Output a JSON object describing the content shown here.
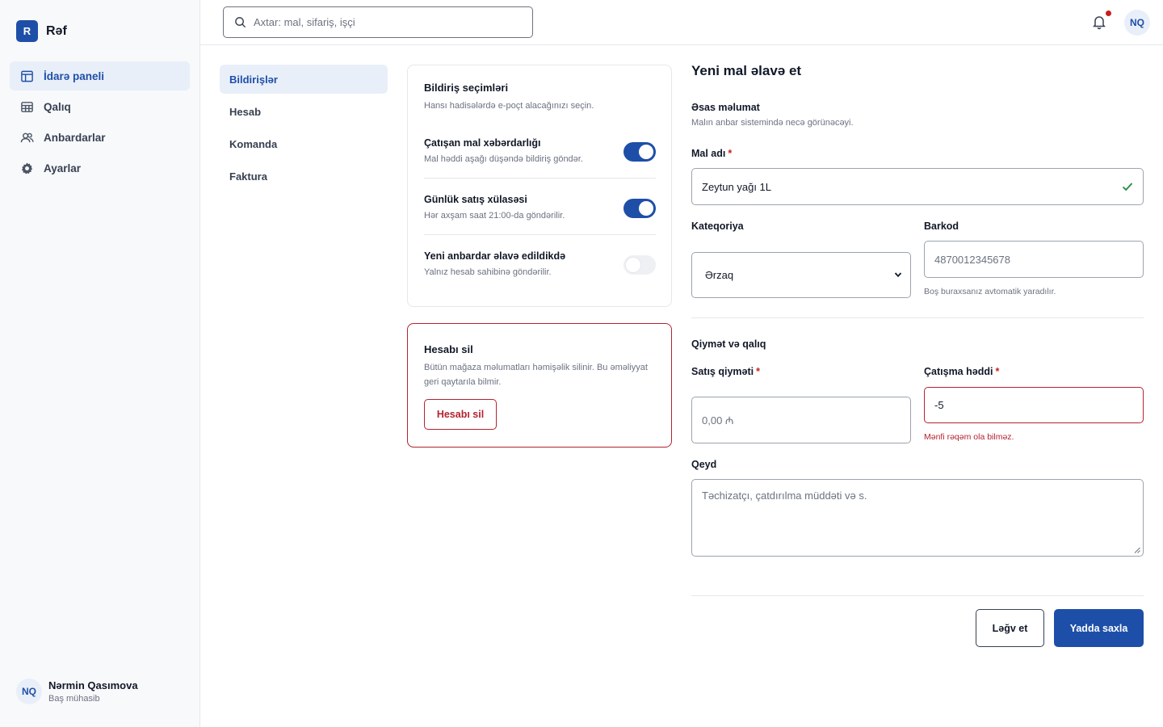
{
  "brand": {
    "logo_letter": "R",
    "name": "Rəf"
  },
  "sidebar": {
    "items": [
      {
        "label": "İdarə paneli",
        "icon": "layout-icon",
        "active": true
      },
      {
        "label": "Qalıq",
        "icon": "table-icon",
        "active": false
      },
      {
        "label": "Anbardarlar",
        "icon": "users-icon",
        "active": false
      },
      {
        "label": "Ayarlar",
        "icon": "gear-icon",
        "active": false
      }
    ],
    "user": {
      "initials": "NQ",
      "name": "Nərmin Qasımova",
      "role": "Baş mühasib"
    }
  },
  "topbar": {
    "search_placeholder": "Axtar: mal, sifariş, işçi",
    "avatar_initials": "NQ",
    "has_notification": true
  },
  "settings_nav": {
    "items": [
      {
        "label": "Bildirişlər",
        "active": true
      },
      {
        "label": "Hesab",
        "active": false
      },
      {
        "label": "Komanda",
        "active": false
      },
      {
        "label": "Faktura",
        "active": false
      }
    ]
  },
  "notifications": {
    "title": "Bildiriş seçimləri",
    "subtitle": "Hansı hadisələrdə e-poçt alacağınızı seçin.",
    "options": [
      {
        "title": "Çatışan mal xəbərdarlığı",
        "subtitle": "Mal həddi aşağı düşəndə bildiriş göndər.",
        "enabled": true
      },
      {
        "title": "Günlük satış xülasəsi",
        "subtitle": "Hər axşam saat 21:00-da göndərilir.",
        "enabled": true
      },
      {
        "title": "Yeni anbardar əlavə edildikdə",
        "subtitle": "Yalnız hesab sahibinə göndərilir.",
        "enabled": false
      }
    ]
  },
  "danger_zone": {
    "title": "Hesabı sil",
    "description": "Bütün mağaza məlumatları həmişəlik silinir. Bu əməliyyat geri qaytarıla bilmir.",
    "button_label": "Hesabı sil",
    "accent_color": "#b4232f"
  },
  "form": {
    "title": "Yeni mal əlavə et",
    "basic": {
      "title": "Əsas məlumat",
      "subtitle": "Malın anbar sistemində necə görünəcəyi.",
      "name_label": "Mal adı",
      "name_value": "Zeytun yağı 1L",
      "category_label": "Kateqoriya",
      "category_value": "Ərzaq",
      "barcode_label": "Barkod",
      "barcode_placeholder": "4870012345678",
      "barcode_hint": "Boş buraxsanız avtomatik yaradılır."
    },
    "price": {
      "title": "Qiymət və qalıq",
      "price_label": "Satış qiyməti",
      "price_placeholder": "0,00 ₼",
      "threshold_label": "Çatışma həddi",
      "threshold_value": "-5",
      "threshold_error": "Mənfi rəqəm ola bilməz."
    },
    "note": {
      "label": "Qeyd",
      "placeholder": "Təchizatçı, çatdırılma müddəti və s."
    },
    "required_mark": "*",
    "cancel_label": "Ləğv et",
    "save_label": "Yadda saxla"
  },
  "colors": {
    "primary": "#1e4fa8",
    "danger": "#b4232f",
    "success": "#1f8a3b"
  }
}
